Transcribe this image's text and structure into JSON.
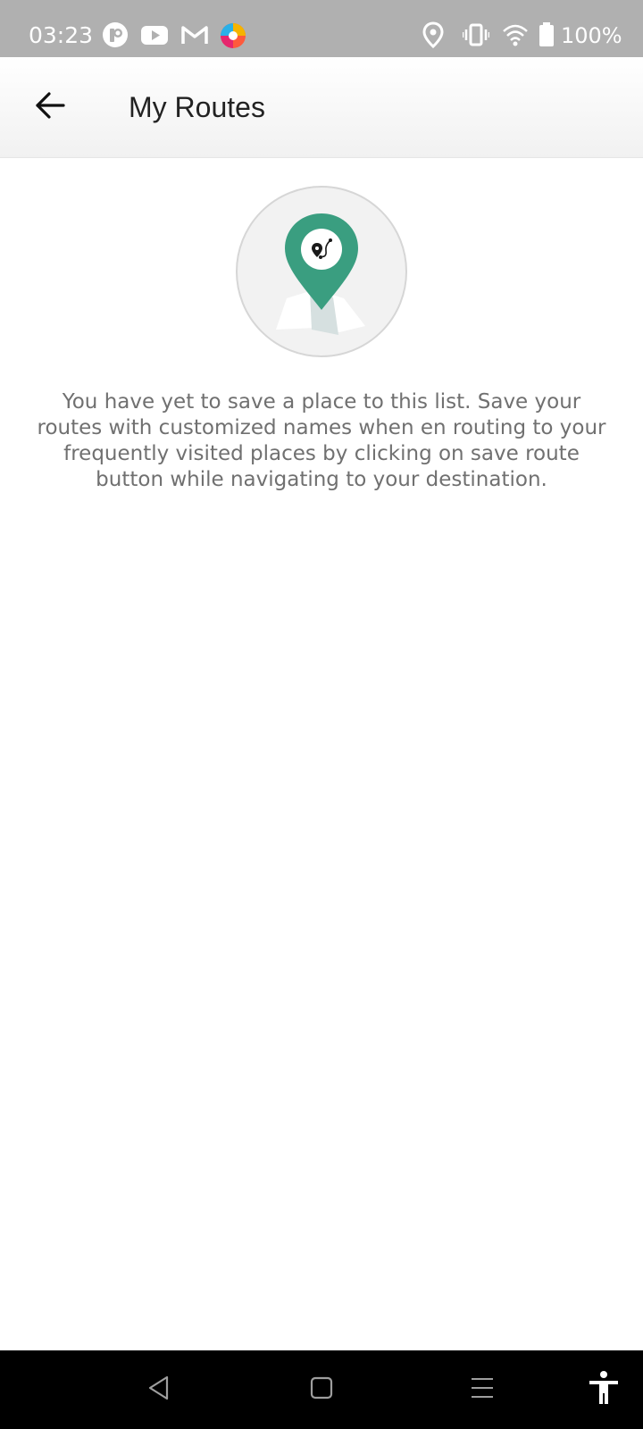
{
  "status_bar": {
    "time": "03:23",
    "battery_percent": "100%",
    "notification_icons": [
      "app-p-icon",
      "youtube-icon",
      "gmail-icon",
      "colorful-app-icon"
    ],
    "system_icons": [
      "location-icon",
      "vibrate-icon",
      "wifi-icon",
      "battery-icon"
    ]
  },
  "app_bar": {
    "title": "My Routes",
    "back_icon": "arrow-left-icon"
  },
  "empty_state": {
    "illustration": "map-pin-route-icon",
    "message": "You have yet to save a place to this list. Save your routes with customized names when en routing to your frequently visited places by clicking on save route button while navigating to your destination."
  },
  "nav_bar": {
    "buttons": [
      "back-triangle-icon",
      "home-square-icon",
      "recents-menu-icon",
      "accessibility-icon"
    ]
  },
  "colors": {
    "status_bar": "#b0b0b0",
    "accent_green": "#3a9e80",
    "text_gray": "#707070",
    "title": "#222222",
    "nav_bar": "#000000"
  }
}
